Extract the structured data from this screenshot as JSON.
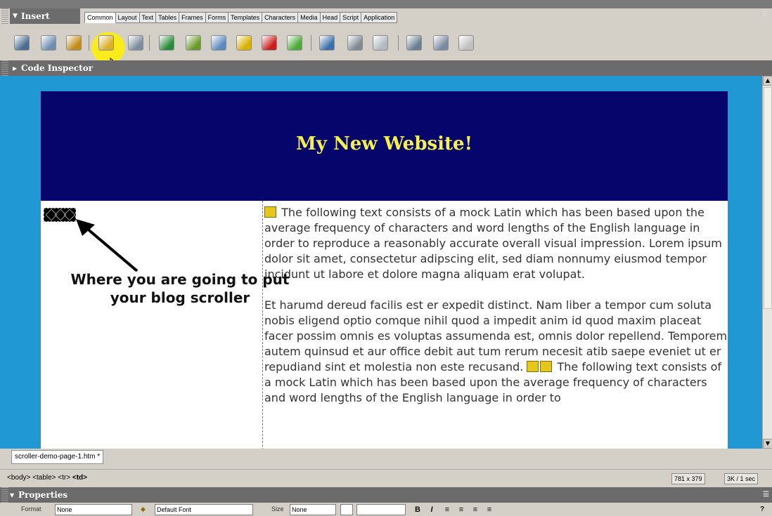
{
  "insert_panel": {
    "title": "Insert",
    "tabs": [
      "Common",
      "Layout",
      "Text",
      "Tables",
      "Frames",
      "Forms",
      "Templates",
      "Characters",
      "Media",
      "Head",
      "Script",
      "Application"
    ],
    "active_tab": "Common",
    "tools": [
      "hyperlink-icon",
      "email-link-icon",
      "named-anchor-icon",
      "table-icon",
      "layer-icon",
      "image-icon",
      "image-placeholder-icon",
      "rollover-image-icon",
      "flash-icon",
      "shockwave-icon",
      "navigation-bar-icon",
      "horizontal-rule-icon",
      "date-icon",
      "tabular-data-icon",
      "comment-icon",
      "tag-chooser-icon",
      "template-icon"
    ]
  },
  "code_inspector": {
    "label": "Code Inspector"
  },
  "document": {
    "site_title": "My New Website!",
    "annotation": "Where you are going to put your blog scroller",
    "paragraph1": "The following text consists of a mock Latin which has been based upon the average frequency of characters and word lengths of the English language in order to reproduce a reasonably accurate overall visual impression. Lorem ipsum dolor sit amet, consectetur adipscing elit, sed diam nonnumy eiusmod tempor incidunt ut labore et dolore magna aliquam erat volupat.",
    "paragraph2a": "Et harumd dereud facilis est er expedit distinct. Nam liber a tempor cum soluta nobis eligend optio comque nihil quod a impedit anim id quod maxim placeat facer possim omnis es voluptas assumenda est, omnis dolor repellend. Temporem autem quinsud et aur office debit aut tum rerum necesit atib saepe eveniet ut er repudiand sint et molestia non este recusand.",
    "paragraph2b": "The following text consists of a mock Latin which has been based upon the average frequency of characters and word lengths of the English language in order to"
  },
  "doc_tab": {
    "filename": "scroller-demo-page-1.htm *"
  },
  "status_bar": {
    "tag_path": "<body> <table> <tr>",
    "tag_current": "<td>",
    "window_size": "781 x 379",
    "download": "3K / 1 sec"
  },
  "properties": {
    "title": "Properties",
    "format_label": "Format",
    "format_value": "None",
    "font_value": "Default Font",
    "size_label": "Size",
    "size_value": "None",
    "bold": "B",
    "italic": "I"
  },
  "colors": {
    "banner": "#05056b",
    "site_title": "#f5f14a",
    "canvas": "#1f98d3",
    "panel_header": "#6b6b6b"
  }
}
